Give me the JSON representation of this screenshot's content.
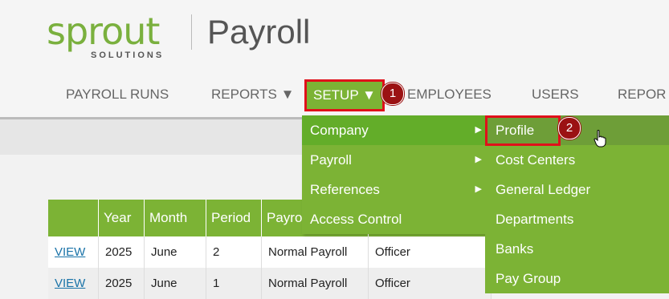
{
  "brand": {
    "logo_word": "sprout",
    "logo_sub": "SOLUTIONS",
    "app_title": "Payroll"
  },
  "nav": {
    "items": [
      {
        "label": "PAYROLL RUNS"
      },
      {
        "label": "REPORTS ▼"
      },
      {
        "label": "SETUP ▼"
      },
      {
        "label": "EMPLOYEES"
      },
      {
        "label": "USERS"
      },
      {
        "label": "REPOR"
      }
    ]
  },
  "badges": {
    "step1": "1",
    "step2": "2"
  },
  "setup_menu": {
    "items": [
      {
        "label": "Company",
        "has_submenu": true
      },
      {
        "label": "Payroll",
        "has_submenu": true
      },
      {
        "label": "References",
        "has_submenu": true
      },
      {
        "label": "Access Control",
        "has_submenu": false
      }
    ]
  },
  "company_submenu": {
    "items": [
      {
        "label": "Profile"
      },
      {
        "label": "Cost Centers"
      },
      {
        "label": "General Ledger"
      },
      {
        "label": "Departments"
      },
      {
        "label": "Banks"
      },
      {
        "label": "Pay Group"
      }
    ]
  },
  "table": {
    "headers": [
      "",
      "Year",
      "Month",
      "Period",
      "Payro Type",
      ""
    ],
    "rows": [
      {
        "action": "VIEW",
        "year": "2025",
        "month": "June",
        "period": "2",
        "type": "Normal Payroll",
        "group": "Officer"
      },
      {
        "action": "VIEW",
        "year": "2025",
        "month": "June",
        "period": "1",
        "type": "Normal Payroll",
        "group": "Officer"
      }
    ]
  },
  "colors": {
    "brand_green": "#7cb335",
    "highlight_red": "#e0101a",
    "badge_red": "#9b1213"
  }
}
